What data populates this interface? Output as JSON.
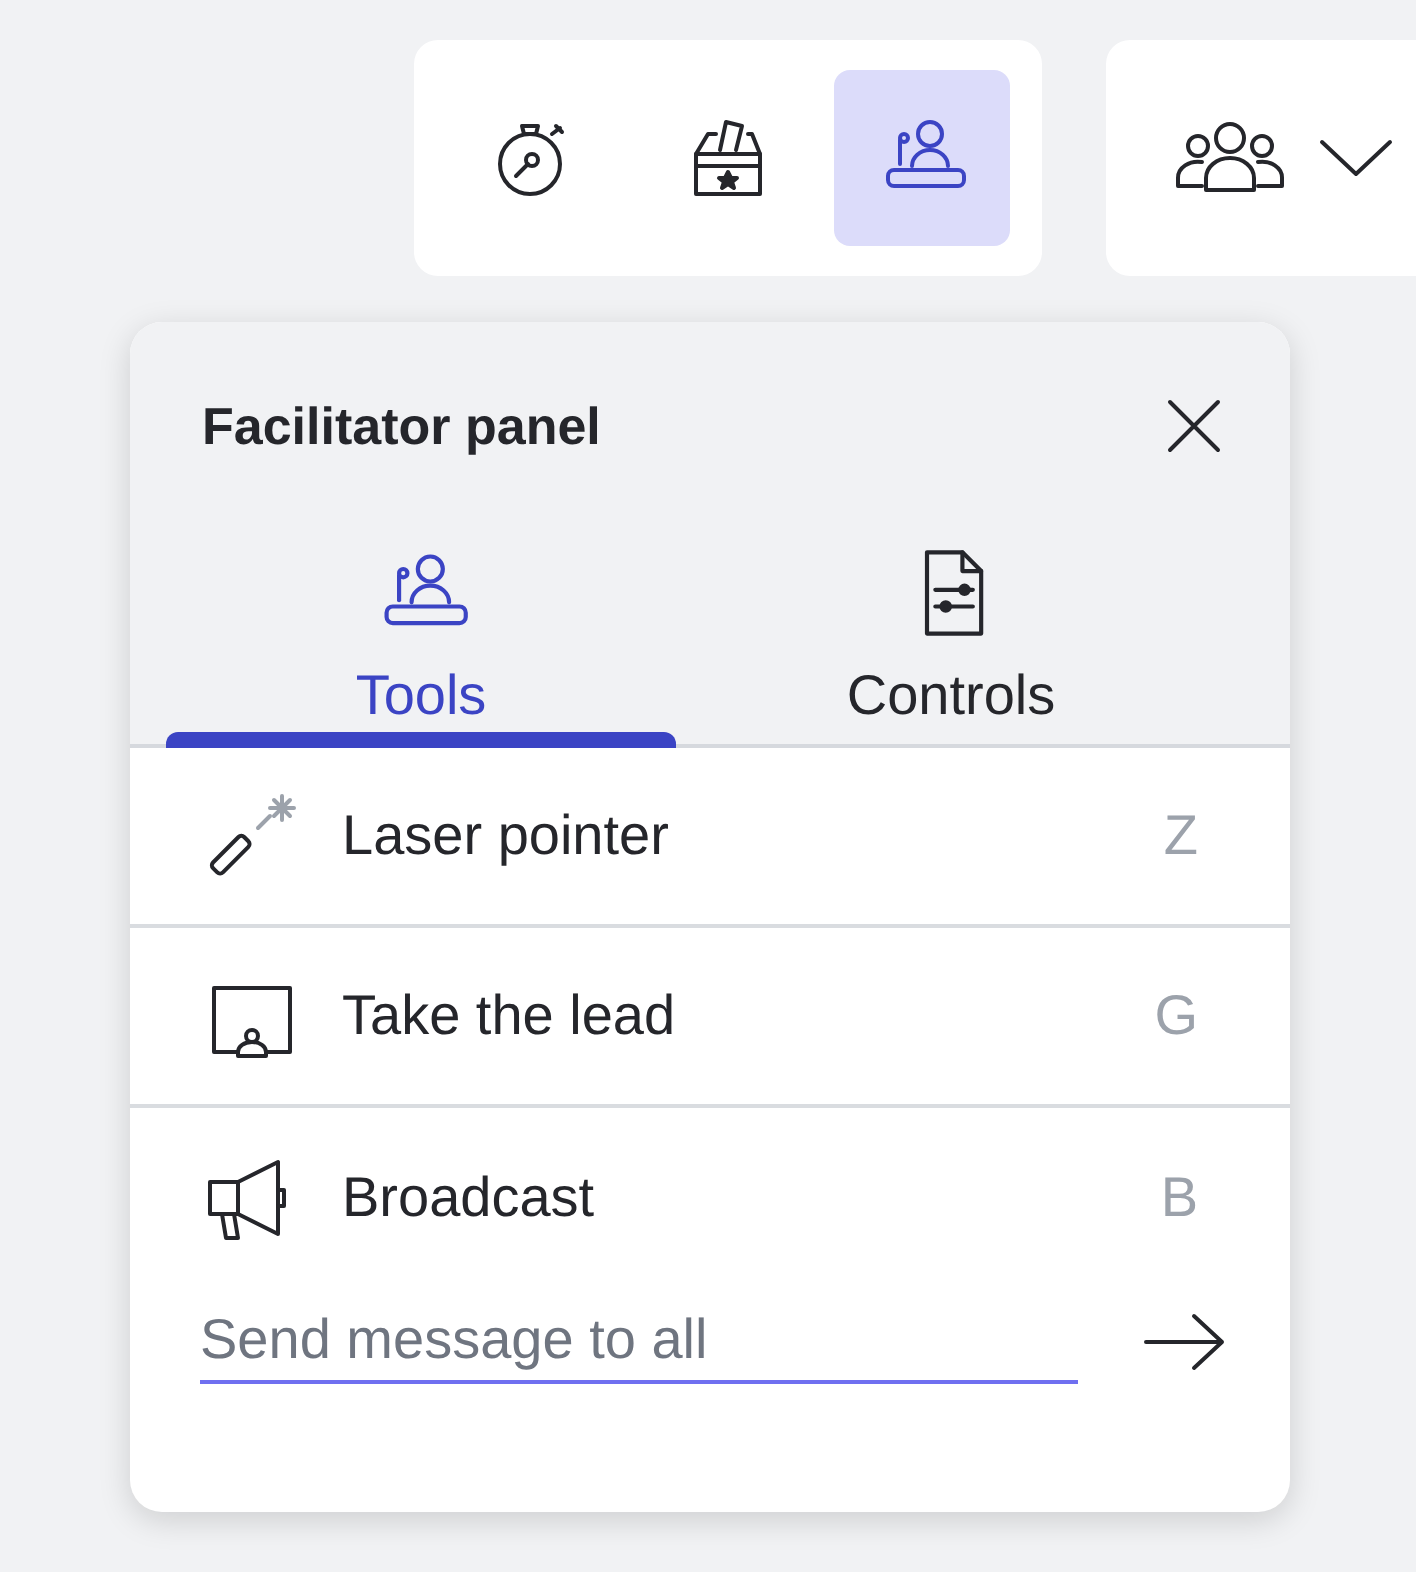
{
  "toolbar": {
    "buttons": [
      {
        "kind": "timer",
        "selected": false
      },
      {
        "kind": "vote",
        "selected": false
      },
      {
        "kind": "facilitator",
        "selected": true
      }
    ]
  },
  "people_menu": {
    "kind": "people"
  },
  "panel": {
    "title": "Facilitator panel",
    "tabs": [
      {
        "label": "Tools",
        "kind": "facilitator",
        "selected": true
      },
      {
        "label": "Controls",
        "kind": "settings-doc",
        "selected": false
      }
    ],
    "tools": [
      {
        "label": "Laser pointer",
        "shortcut": "Z",
        "kind": "laser"
      },
      {
        "label": "Take the lead",
        "shortcut": "G",
        "kind": "lead"
      },
      {
        "label": "Broadcast",
        "shortcut": "B",
        "kind": "broadcast"
      }
    ],
    "message": {
      "placeholder": "Send message to all"
    }
  }
}
